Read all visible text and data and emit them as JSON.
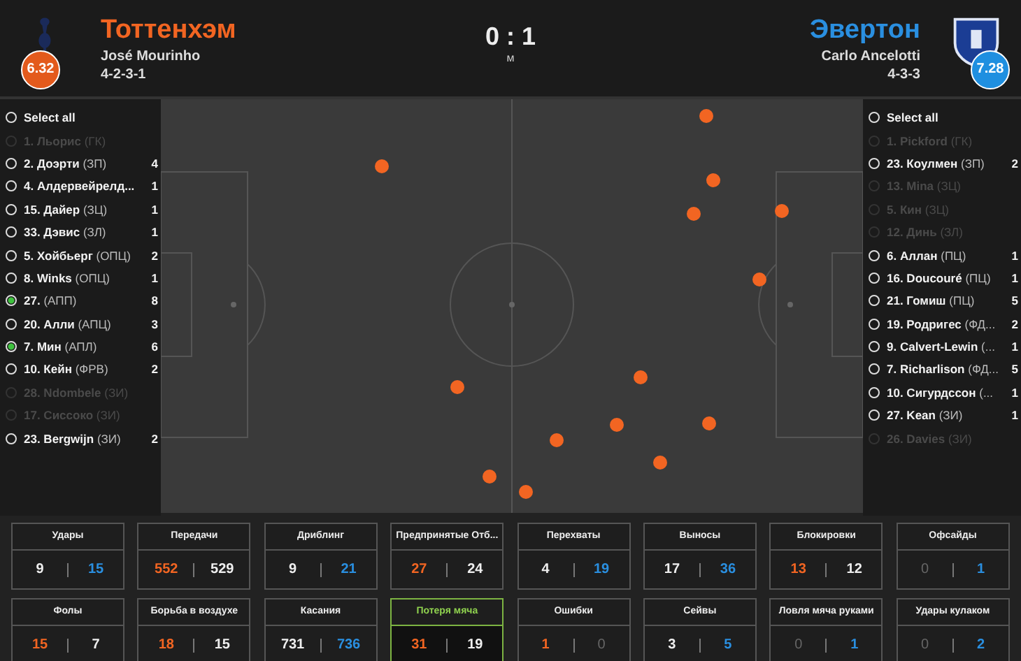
{
  "home": {
    "name": "Тоттенхэм",
    "manager": "José Mourinho",
    "formation": "4-2-3-1",
    "rating": "6.32"
  },
  "score": {
    "text": "0 : 1",
    "status": "м"
  },
  "away": {
    "name": "Эвертон",
    "manager": "Carlo Ancelotti",
    "formation": "4-3-3",
    "rating": "7.28"
  },
  "home_players": [
    {
      "name": "Select all",
      "available": true,
      "selected": false
    },
    {
      "name": "1. Льорис",
      "position": "(ГК)",
      "available": false,
      "selected": false
    },
    {
      "name": "2. Доэрти",
      "position": "(ЗП)",
      "count": "4",
      "available": true,
      "selected": false
    },
    {
      "name": "4. Алдервейрелд...",
      "count": "1",
      "available": true,
      "selected": false
    },
    {
      "name": "15. Дайер",
      "position": "(ЗЦ)",
      "count": "1",
      "available": true,
      "selected": false
    },
    {
      "name": "33. Дэвис",
      "position": "(ЗЛ)",
      "count": "1",
      "available": true,
      "selected": false
    },
    {
      "name": "5. Хойбьерг",
      "position": "(ОПЦ)",
      "count": "2",
      "available": true,
      "selected": false
    },
    {
      "name": "8. Winks",
      "position": "(ОПЦ)",
      "count": "1",
      "available": true,
      "selected": false
    },
    {
      "name": "27.",
      "position": "(АПП)",
      "count": "8",
      "available": true,
      "selected": true
    },
    {
      "name": "20. Алли",
      "position": "(АПЦ)",
      "count": "3",
      "available": true,
      "selected": false
    },
    {
      "name": "7. Мин",
      "position": "(АПЛ)",
      "count": "6",
      "available": true,
      "selected": true
    },
    {
      "name": "10. Кейн",
      "position": "(ФРВ)",
      "count": "2",
      "available": true,
      "selected": false
    },
    {
      "name": "28. Ndombele",
      "position": "(ЗИ)",
      "available": false,
      "selected": false
    },
    {
      "name": "17. Сиссоко",
      "position": "(ЗИ)",
      "available": false,
      "selected": false
    },
    {
      "name": "23. Bergwijn",
      "position": "(ЗИ)",
      "count": "2",
      "available": true,
      "selected": false
    }
  ],
  "away_players": [
    {
      "name": "Select all",
      "available": true,
      "selected": false
    },
    {
      "name": "1. Pickford",
      "position": "(ГК)",
      "available": false,
      "selected": false
    },
    {
      "name": "23. Коулмен",
      "position": "(ЗП)",
      "count": "2",
      "available": true,
      "selected": false
    },
    {
      "name": "13. Mina",
      "position": "(ЗЦ)",
      "available": false,
      "selected": false
    },
    {
      "name": "5. Кин",
      "position": "(ЗЦ)",
      "available": false,
      "selected": false
    },
    {
      "name": "12. Динь",
      "position": "(ЗЛ)",
      "available": false,
      "selected": false
    },
    {
      "name": "6. Аллан",
      "position": "(ПЦ)",
      "count": "1",
      "available": true,
      "selected": false
    },
    {
      "name": "16. Doucouré",
      "position": "(ПЦ)",
      "count": "1",
      "available": true,
      "selected": false
    },
    {
      "name": "21. Гомиш",
      "position": "(ПЦ)",
      "count": "5",
      "available": true,
      "selected": false
    },
    {
      "name": "19. Родригес",
      "position": "(ФД...",
      "count": "2",
      "available": true,
      "selected": false
    },
    {
      "name": "9. Calvert-Lewin",
      "position": "(...",
      "count": "1",
      "available": true,
      "selected": false
    },
    {
      "name": "7. Richarlison",
      "position": "(ФД...",
      "count": "5",
      "available": true,
      "selected": false
    },
    {
      "name": "10. Сигурдссон",
      "position": "(...",
      "count": "1",
      "available": true,
      "selected": false
    },
    {
      "name": "27. Kean",
      "position": "(ЗИ)",
      "count": "1",
      "available": true,
      "selected": false
    },
    {
      "name": "26. Davies",
      "position": "(ЗИ)",
      "available": false,
      "selected": false
    }
  ],
  "stats": [
    {
      "label": "Удары",
      "home": "9",
      "home_leads": false,
      "home_dim": false,
      "away": "15",
      "away_leads": true,
      "away_dim": false,
      "selected": false
    },
    {
      "label": "Передачи",
      "home": "552",
      "home_leads": true,
      "home_dim": false,
      "away": "529",
      "away_leads": false,
      "away_dim": false,
      "selected": false
    },
    {
      "label": "Дриблинг",
      "home": "9",
      "home_leads": false,
      "home_dim": false,
      "away": "21",
      "away_leads": true,
      "away_dim": false,
      "selected": false
    },
    {
      "label": "Предпринятые Отб...",
      "home": "27",
      "home_leads": true,
      "home_dim": false,
      "away": "24",
      "away_leads": false,
      "away_dim": false,
      "selected": false
    },
    {
      "label": "Перехваты",
      "home": "4",
      "home_leads": false,
      "home_dim": false,
      "away": "19",
      "away_leads": true,
      "away_dim": false,
      "selected": false
    },
    {
      "label": "Выносы",
      "home": "17",
      "home_leads": false,
      "home_dim": false,
      "away": "36",
      "away_leads": true,
      "away_dim": false,
      "selected": false
    },
    {
      "label": "Блокировки",
      "home": "13",
      "home_leads": true,
      "home_dim": false,
      "away": "12",
      "away_leads": false,
      "away_dim": false,
      "selected": false
    },
    {
      "label": "Офсайды",
      "home": "0",
      "home_leads": false,
      "home_dim": true,
      "away": "1",
      "away_leads": true,
      "away_dim": false,
      "selected": false
    },
    {
      "label": "Фолы",
      "home": "15",
      "home_leads": true,
      "home_dim": false,
      "away": "7",
      "away_leads": false,
      "away_dim": false,
      "selected": false
    },
    {
      "label": "Борьба в воздухе",
      "home": "18",
      "home_leads": true,
      "home_dim": false,
      "away": "15",
      "away_leads": false,
      "away_dim": false,
      "selected": false
    },
    {
      "label": "Касания",
      "home": "731",
      "home_leads": false,
      "home_dim": false,
      "away": "736",
      "away_leads": true,
      "away_dim": false,
      "selected": false
    },
    {
      "label": "Потеря мяча",
      "home": "31",
      "home_leads": true,
      "home_dim": false,
      "away": "19",
      "away_leads": false,
      "away_dim": false,
      "selected": true
    },
    {
      "label": "Ошибки",
      "home": "1",
      "home_leads": true,
      "home_dim": false,
      "away": "0",
      "away_leads": false,
      "away_dim": true,
      "selected": false
    },
    {
      "label": "Сейвы",
      "home": "3",
      "home_leads": false,
      "home_dim": false,
      "away": "5",
      "away_leads": true,
      "away_dim": false,
      "selected": false
    },
    {
      "label": "Ловля мяча руками",
      "home": "0",
      "home_leads": false,
      "home_dim": true,
      "away": "1",
      "away_leads": true,
      "away_dim": false,
      "selected": false
    },
    {
      "label": "Удары кулаком",
      "home": "0",
      "home_leads": false,
      "home_dim": true,
      "away": "2",
      "away_leads": true,
      "away_dim": false,
      "selected": false
    }
  ]
}
